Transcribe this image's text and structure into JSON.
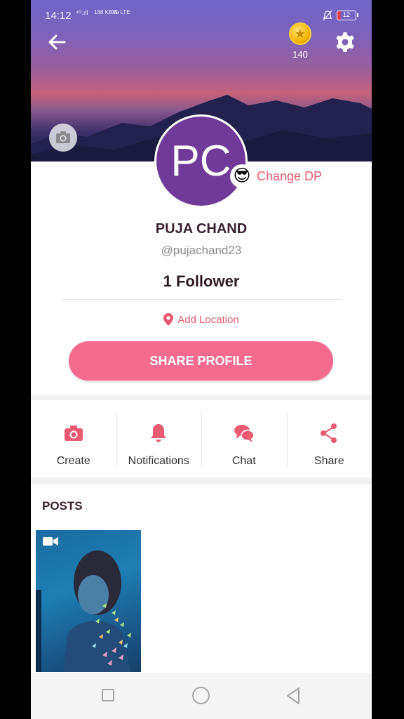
{
  "status_bar": {
    "time": "14:12",
    "signal": "⁴ᴳ.ıll",
    "net_speed": "188 KB/S",
    "net_type": "Vo LTE",
    "battery": "12"
  },
  "header": {
    "coins": "140",
    "icons": [
      "back-arrow-icon",
      "coin-star-icon",
      "gear-icon",
      "camera-icon"
    ]
  },
  "profile": {
    "initials": "PC",
    "change_dp_emoji": "😎",
    "change_dp_label": "Change DP",
    "name": "PUJA CHAND",
    "handle": "@pujachand23",
    "followers": "1 Follower",
    "location_label": "Add Location",
    "share_button": "SHARE PROFILE"
  },
  "actions": [
    {
      "label": "Create",
      "icon": "camera-icon"
    },
    {
      "label": "Notifications",
      "icon": "bell-icon"
    },
    {
      "label": "Chat",
      "icon": "chat-bubbles-icon"
    },
    {
      "label": "Share",
      "icon": "share-icon"
    }
  ],
  "posts": {
    "title": "POSTS",
    "items": [
      {
        "type": "video"
      }
    ]
  },
  "colors": {
    "accent": "#f56b8f",
    "accent_text": "#e85a73",
    "avatar": "#6f3a98"
  }
}
